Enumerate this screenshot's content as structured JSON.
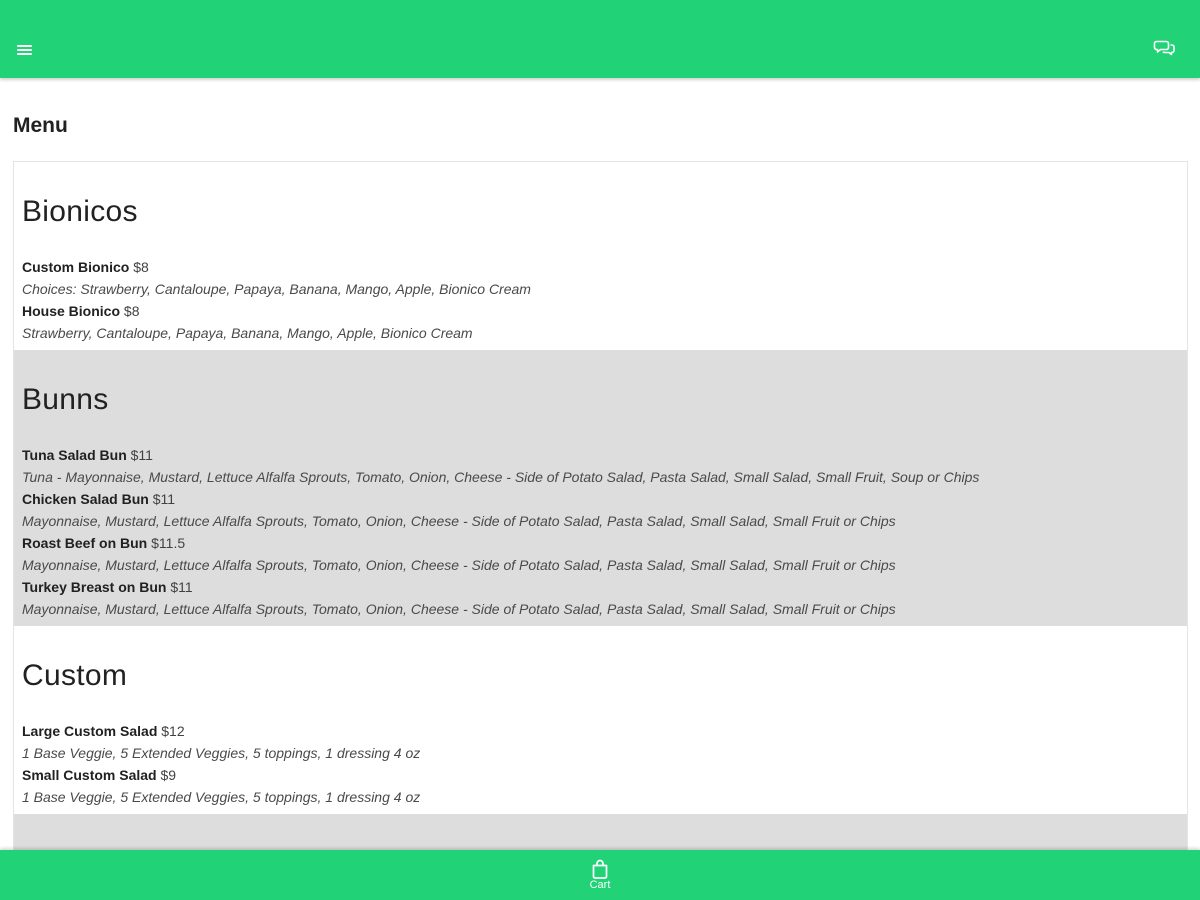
{
  "colors": {
    "accent": "#22d276",
    "alt_row": "#dddddd",
    "text": "#212121"
  },
  "header": {
    "menu_icon": "hamburger-icon",
    "chat_icon": "chat-icon"
  },
  "page": {
    "title": "Menu"
  },
  "sections": [
    {
      "title": "Bionicos",
      "items": [
        {
          "name": "Custom Bionico",
          "price": "$8",
          "description": "Choices: Strawberry, Cantaloupe, Papaya, Banana, Mango, Apple, Bionico Cream"
        },
        {
          "name": "House Bionico",
          "price": "$8",
          "description": "Strawberry, Cantaloupe, Papaya, Banana, Mango, Apple, Bionico Cream"
        }
      ]
    },
    {
      "title": "Bunns",
      "items": [
        {
          "name": "Tuna Salad Bun",
          "price": "$11",
          "description": "Tuna - Mayonnaise, Mustard, Lettuce Alfalfa Sprouts, Tomato, Onion, Cheese - Side of Potato Salad, Pasta Salad, Small Salad, Small Fruit, Soup or Chips"
        },
        {
          "name": "Chicken Salad Bun",
          "price": "$11",
          "description": "Mayonnaise, Mustard, Lettuce Alfalfa Sprouts, Tomato, Onion, Cheese - Side of Potato Salad, Pasta Salad, Small Salad, Small Fruit or Chips"
        },
        {
          "name": "Roast Beef on Bun",
          "price": "$11.5",
          "description": "Mayonnaise, Mustard, Lettuce Alfalfa Sprouts, Tomato, Onion, Cheese - Side of Potato Salad, Pasta Salad, Small Salad, Small Fruit or Chips"
        },
        {
          "name": "Turkey Breast on Bun",
          "price": "$11",
          "description": "Mayonnaise, Mustard, Lettuce Alfalfa Sprouts, Tomato, Onion, Cheese - Side of Potato Salad, Pasta Salad, Small Salad, Small Fruit or Chips"
        }
      ]
    },
    {
      "title": "Custom",
      "items": [
        {
          "name": "Large Custom Salad",
          "price": "$12",
          "description": "1 Base Veggie, 5 Extended Veggies,  5 toppings,  1 dressing 4 oz"
        },
        {
          "name": "Small Custom Salad",
          "price": "$9",
          "description": "1 Base Veggie, 5 Extended Veggies,  5 toppings,  1 dressing 4 oz"
        }
      ]
    }
  ],
  "bottom_nav": {
    "cart_label": "Cart",
    "cart_icon": "shopping-bag-icon"
  }
}
